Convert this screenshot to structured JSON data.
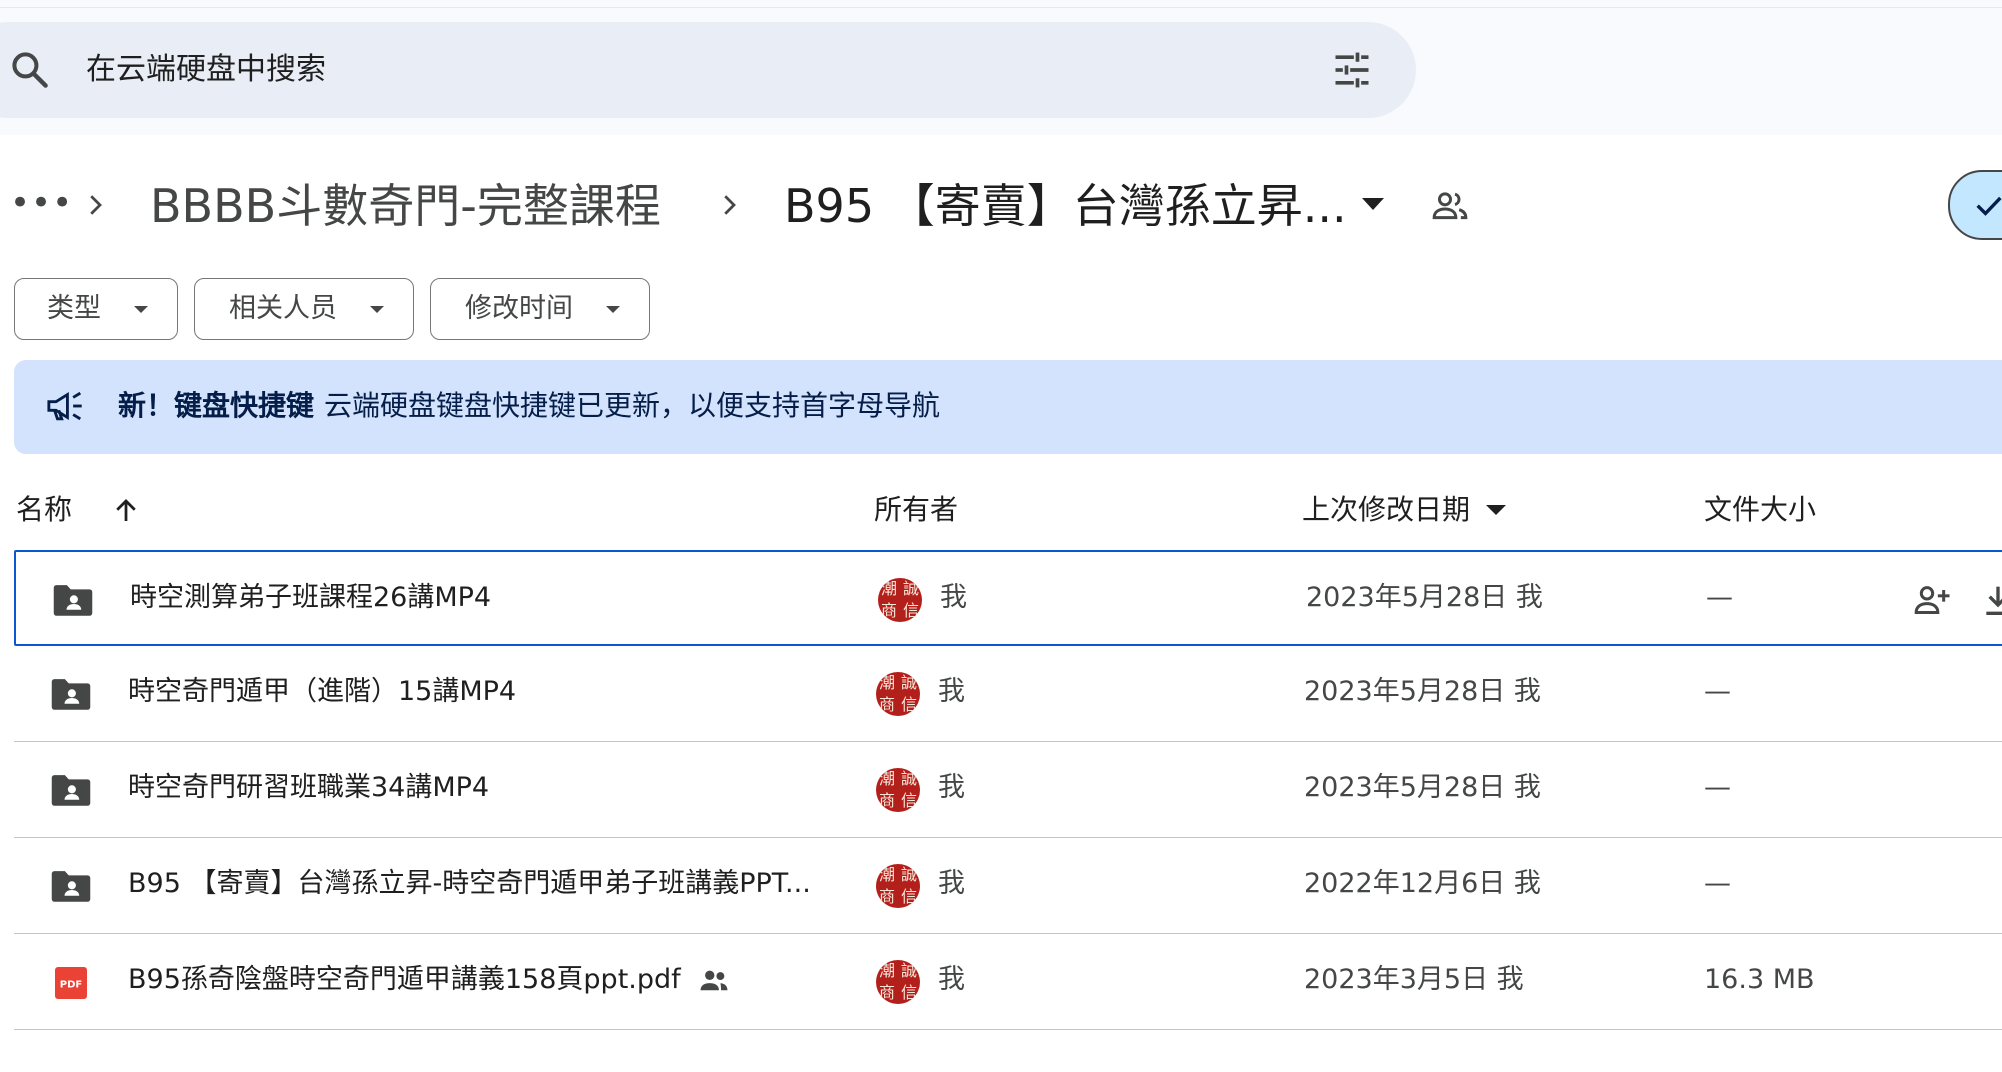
{
  "search": {
    "placeholder": "在云端硬盘中搜索",
    "icon": "search-icon",
    "filter_icon": "tune-icon"
  },
  "breadcrumb": {
    "overflow": "•••",
    "items": [
      "BBBB斗數奇門-完整課程",
      "B95 【寄賣】台灣孫立昇..."
    ],
    "current_icon": "people-icon",
    "view_icon": "check-icon"
  },
  "filters": [
    {
      "label": "类型"
    },
    {
      "label": "相关人员"
    },
    {
      "label": "修改时间"
    }
  ],
  "banner": {
    "title": "新！键盘快捷键",
    "text": "云端硬盘键盘快捷键已更新，以便支持首字母导航",
    "icon": "megaphone-icon"
  },
  "table": {
    "headers": {
      "name": "名称",
      "owner": "所有者",
      "modified": "上次修改日期",
      "size": "文件大小"
    },
    "avatar_chars": [
      "潮",
      "誠",
      "商",
      "信"
    ],
    "rows": [
      {
        "name": "時空測算弟子班課程26講MP4",
        "type": "shared-folder",
        "owner": "我",
        "modified": "2023年5月28日 我",
        "size": "—",
        "selected": true
      },
      {
        "name": "時空奇門遁甲（進階）15講MP4",
        "type": "shared-folder",
        "owner": "我",
        "modified": "2023年5月28日 我",
        "size": "—"
      },
      {
        "name": "時空奇門研習班職業34講MP4",
        "type": "shared-folder",
        "owner": "我",
        "modified": "2023年5月28日 我",
        "size": "—"
      },
      {
        "name": "B95 【寄賣】台灣孫立昇-時空奇門遁甲弟子班講義PPT...",
        "type": "shared-folder",
        "owner": "我",
        "modified": "2022年12月6日 我",
        "size": "—"
      },
      {
        "name": "B95孫奇陰盤時空奇門遁甲講義158頁ppt.pdf",
        "type": "pdf",
        "badge": "PDF",
        "owner": "我",
        "modified": "2023年3月5日 我",
        "size": "16.3 MB",
        "shared": true
      }
    ]
  },
  "colors": {
    "accent": "#0b57d0",
    "banner": "#d3e3fd",
    "pdf": "#ea4335",
    "avatar": "#b3201c"
  }
}
